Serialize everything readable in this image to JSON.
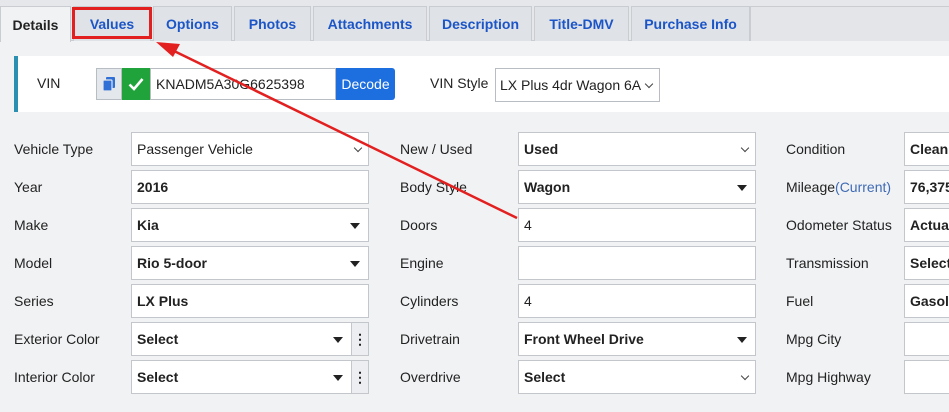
{
  "tabs": [
    {
      "label": "Details"
    },
    {
      "label": "Values"
    },
    {
      "label": "Options"
    },
    {
      "label": "Photos"
    },
    {
      "label": "Attachments"
    },
    {
      "label": "Description"
    },
    {
      "label": "Title-DMV"
    },
    {
      "label": "Purchase Info"
    }
  ],
  "vin": {
    "label": "VIN",
    "value": "KNADM5A30G6625398",
    "decode_label": "Decode",
    "style_label": "VIN Style",
    "style_value": "LX Plus 4dr Wagon 6A"
  },
  "col1": [
    {
      "label": "Vehicle Type",
      "value": "Passenger Vehicle"
    },
    {
      "label": "Year",
      "value": "2016"
    },
    {
      "label": "Make",
      "value": "Kia"
    },
    {
      "label": "Model",
      "value": "Rio 5-door"
    },
    {
      "label": "Series",
      "value": "LX Plus"
    },
    {
      "label": "Exterior Color",
      "value": "Select"
    },
    {
      "label": "Interior Color",
      "value": "Select"
    }
  ],
  "col2": [
    {
      "label": "New / Used",
      "value": "Used"
    },
    {
      "label": "Body Style",
      "value": "Wagon"
    },
    {
      "label": "Doors",
      "value": "4"
    },
    {
      "label": "Engine",
      "value": ""
    },
    {
      "label": "Cylinders",
      "value": "4"
    },
    {
      "label": "Drivetrain",
      "value": "Front Wheel Drive"
    },
    {
      "label": "Overdrive",
      "value": "Select"
    }
  ],
  "col3": [
    {
      "label": "Condition",
      "value": "Clean"
    },
    {
      "label": "Mileage",
      "label_sub": "(Current)",
      "value": "76,375"
    },
    {
      "label": "Odometer Status",
      "value": "Actual"
    },
    {
      "label": "Transmission",
      "value": "Select"
    },
    {
      "label": "Fuel",
      "value": "Gasoline"
    },
    {
      "label": "Mpg City",
      "value": ""
    },
    {
      "label": "Mpg Highway",
      "value": ""
    }
  ],
  "colors": {
    "tab_text": "#1b55c8",
    "decode_bg": "#1d6fe0",
    "check_bg": "#21a33b",
    "annotation": "#e32020",
    "panel_accent": "#2a8fb1"
  }
}
